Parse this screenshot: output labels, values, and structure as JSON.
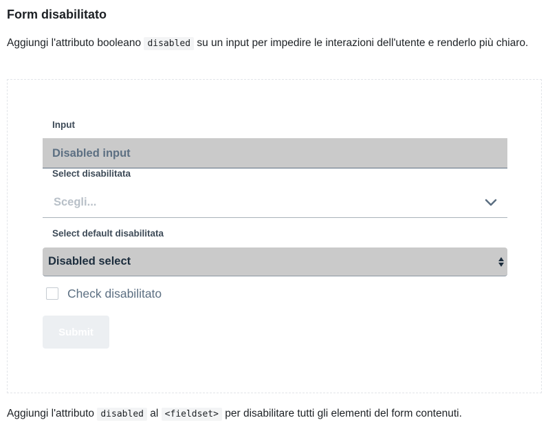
{
  "title": "Form disabilitato",
  "intro": {
    "before": "Aggiungi l'attributo booleano ",
    "code": "disabled",
    "after": " su un input per impedire le interazioni dell'utente e renderlo più chiaro."
  },
  "form": {
    "input": {
      "label": "Input",
      "value": "Disabled input"
    },
    "select": {
      "label": "Select disabilitata",
      "placeholder": "Scegli...",
      "icon": "chevron-down-icon"
    },
    "default_select": {
      "label": "Select default disabilitata",
      "value": "Disabled select",
      "icon": "sort-arrows-icon"
    },
    "checkbox": {
      "label": "Check disabilitato",
      "checked": false
    },
    "submit_label": "Submit"
  },
  "footer": {
    "before": "Aggiungi l'attributo ",
    "code1": "disabled",
    "middle": " al ",
    "code2": "<fieldset>",
    "after": " per disabilitare tutti gli elementi del form contenuti."
  },
  "colors": {
    "disabled_bg": "#cacaca",
    "label_text": "#3d4a57",
    "muted_text": "#5c6f82",
    "submit_bg": "#eceff2"
  }
}
